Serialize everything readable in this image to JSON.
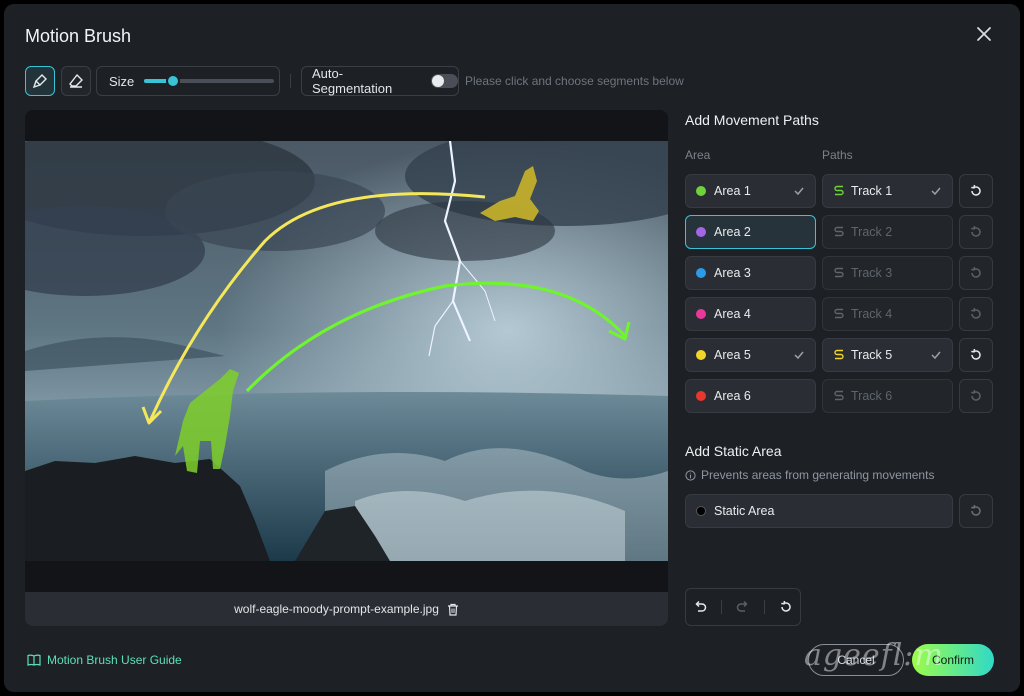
{
  "window": {
    "title": "Motion Brush"
  },
  "toolbar": {
    "size_label": "Size",
    "size_value_pct": 22,
    "autoseg_label": "Auto-Segmentation",
    "autoseg_on": false,
    "hint": "Please click and choose segments below"
  },
  "image": {
    "file_name": "wolf-eagle-moody-prompt-example.jpg"
  },
  "paths": {
    "title": "Add Movement Paths",
    "col_area": "Area",
    "col_paths": "Paths",
    "rows": [
      {
        "area": "Area 1",
        "color": "#6fd23a",
        "area_done": true,
        "track": "Track 1",
        "track_done": true
      },
      {
        "area": "Area 2",
        "color": "#a566e6",
        "area_done": false,
        "track": "Track 2",
        "track_done": false
      },
      {
        "area": "Area 3",
        "color": "#2a9be8",
        "area_done": false,
        "track": "Track 3",
        "track_done": false
      },
      {
        "area": "Area 4",
        "color": "#e8399a",
        "area_done": false,
        "track": "Track 4",
        "track_done": false
      },
      {
        "area": "Area 5",
        "color": "#f2d52a",
        "area_done": true,
        "track": "Track 5",
        "track_done": true
      },
      {
        "area": "Area 6",
        "color": "#e8382e",
        "area_done": false,
        "track": "Track 6",
        "track_done": false
      }
    ]
  },
  "static": {
    "title": "Add Static Area",
    "info": "Prevents areas from generating movements",
    "label": "Static Area"
  },
  "footer": {
    "guide": "Motion Brush User Guide",
    "cancel": "Cancel",
    "confirm": "Confirm"
  },
  "colors": {
    "accent": "#38c3d6",
    "guide": "#5ce0b6"
  }
}
